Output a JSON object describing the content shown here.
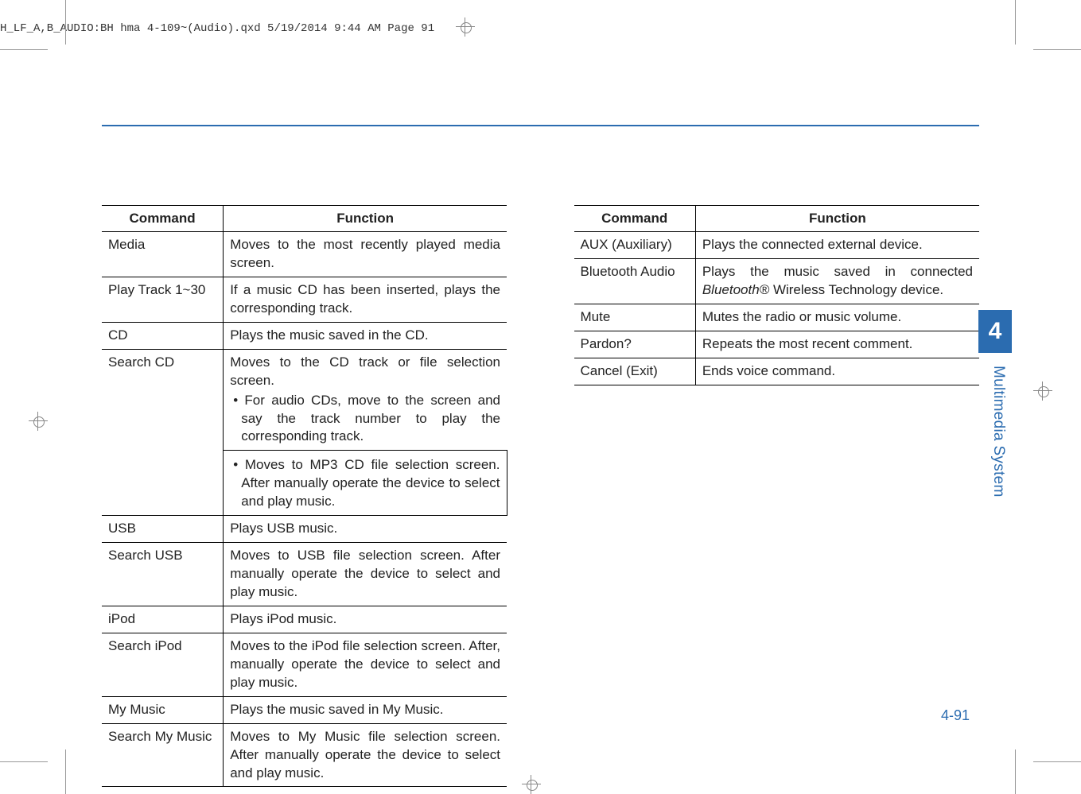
{
  "header_text": "H_LF_A,B_AUDIO:BH hma 4-109~(Audio).qxd  5/19/2014  9:44 AM  Page 91",
  "side_tab_number": "4",
  "side_label": "Multimedia System",
  "page_number": "4-91",
  "left_table": {
    "headers": {
      "command": "Command",
      "function": "Function"
    },
    "rows": [
      {
        "command": "Media",
        "function": "Moves to the most recently played media screen."
      },
      {
        "command": "Play Track 1~30",
        "function": "If a music CD has been inserted, plays the corresponding track."
      },
      {
        "command": "CD",
        "function": "Plays the music saved in the CD."
      },
      {
        "command": "Search CD",
        "function_part1": "Moves to the CD track or file selection screen.",
        "bullet1": "• For audio CDs, move to the screen and say the track number to play the corresponding track.",
        "bullet2": "• Moves to MP3 CD file selection screen. After manually operate the device to select and play music."
      },
      {
        "command": "USB",
        "function": "Plays USB music."
      },
      {
        "command": "Search USB",
        "function": "Moves to USB file selection screen. After manually operate the device to select and play music."
      },
      {
        "command": "iPod",
        "function": "Plays iPod music."
      },
      {
        "command": "Search iPod",
        "function": "Moves to the iPod file selection screen. After, manually operate the device to select and play music."
      },
      {
        "command": "My Music",
        "function": "Plays the music saved in My Music."
      },
      {
        "command": "Search My Music",
        "function": "Moves to My Music file selection screen. After manually operate the device to select and play music."
      }
    ]
  },
  "right_table": {
    "headers": {
      "command": "Command",
      "function": "Function"
    },
    "rows": [
      {
        "command": "AUX (Auxiliary)",
        "function": "Plays the connected external device."
      },
      {
        "command": "Bluetooth Audio",
        "function_pre": "Plays the music saved in connected ",
        "function_italic": "Bluetooth®",
        "function_post": " Wireless Technology device."
      },
      {
        "command": "Mute",
        "function": "Mutes the radio or music volume."
      },
      {
        "command": "Pardon?",
        "function": "Repeats the most recent comment."
      },
      {
        "command": "Cancel (Exit)",
        "function": "Ends voice command."
      }
    ]
  }
}
